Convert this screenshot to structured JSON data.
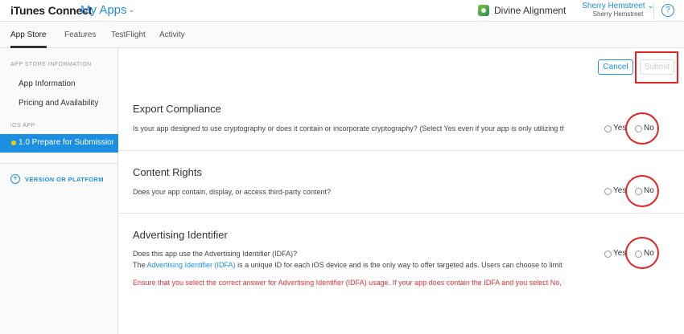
{
  "header": {
    "brand": "iTunes Connect",
    "section": "My Apps",
    "app_name": "Divine Alignment",
    "user_name": "Sherry Hemstreet",
    "user_org": "Sherry Hemstreet",
    "help_symbol": "?"
  },
  "tabs": [
    {
      "label": "App Store",
      "active": true
    },
    {
      "label": "Features",
      "active": false
    },
    {
      "label": "TestFlight",
      "active": false
    },
    {
      "label": "Activity",
      "active": false
    }
  ],
  "sidebar": {
    "header_info": "APP STORE INFORMATION",
    "items": [
      "App Information",
      "Pricing and Availability"
    ],
    "header_ios": "iOS APP",
    "selected_version": "1.0 Prepare for Submission",
    "add_label": "VERSION OR PLATFORM"
  },
  "actions": {
    "cancel": "Cancel",
    "submit": "Submit"
  },
  "sections": {
    "export": {
      "title": "Export Compliance",
      "question": "Is your app designed to use cryptography or does it contain or incorporate cryptography? (Select Yes even if your app is only utilizing the encryption available in iOS or macOS.)",
      "yes": "Yes",
      "no": "No"
    },
    "content": {
      "title": "Content Rights",
      "question": "Does your app contain, display, or access third-party content?",
      "yes": "Yes",
      "no": "No"
    },
    "idfa": {
      "title": "Advertising Identifier",
      "question": "Does this app use the Advertising Identifier (IDFA)?",
      "info_prefix": "The ",
      "info_link": "Advertising Identifier (IDFA)",
      "info_suffix": " is a unique ID for each iOS device and is the only way to offer targeted ads. Users can choose to limit ad targeting on their iOS device.",
      "warning": "Ensure that you select the correct answer for Advertising Identifier (IDFA) usage. If your app does contain the IDFA and you select No, the binary will be rejected.",
      "yes": "Yes",
      "no": "No"
    }
  },
  "colors": {
    "accent": "#1d8fe2",
    "highlight": "#e42222",
    "warning": "#e0303a",
    "status_dot": "#f7d000"
  }
}
